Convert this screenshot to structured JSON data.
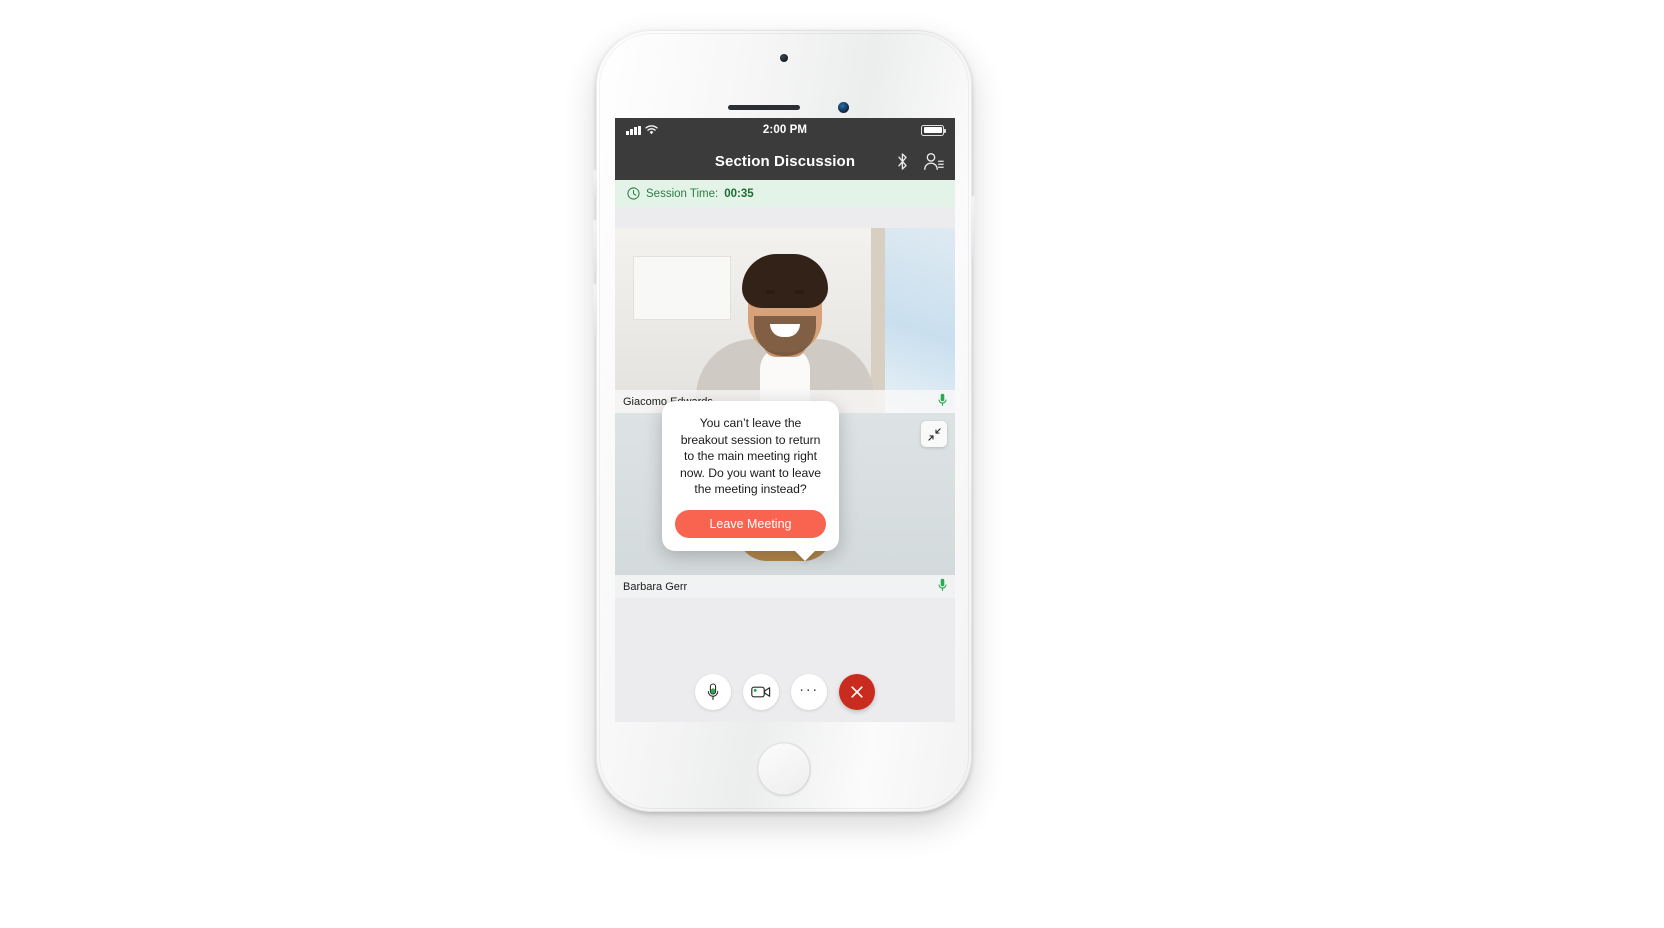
{
  "status_bar": {
    "signal_icon": "cellular-bars-icon",
    "wifi_icon": "wifi-icon",
    "time": "2:00 PM",
    "battery_icon": "battery-full-icon"
  },
  "nav_bar": {
    "title": "Section Discussion",
    "bluetooth_icon": "bluetooth-icon",
    "participants_icon": "participants-icon"
  },
  "session_bar": {
    "clock_icon": "clock-icon",
    "label": "Session Time:",
    "time": "00:35"
  },
  "participants": [
    {
      "name": "Giacomo Edwards",
      "mic_icon": "microphone-active-icon"
    },
    {
      "name": "Barbara Gerr",
      "mic_icon": "microphone-active-icon"
    }
  ],
  "collapse_button": {
    "icon": "collapse-arrows-icon"
  },
  "popover": {
    "message": "You can’t leave the breakout session to return to the main meeting right now. Do you want to leave the meeting instead?",
    "button_label": "Leave Meeting"
  },
  "toolbar": {
    "buttons": [
      {
        "name": "mute-button",
        "icon": "microphone-icon"
      },
      {
        "name": "video-button",
        "icon": "video-camera-icon"
      },
      {
        "name": "more-button",
        "icon": "ellipsis-icon",
        "label": "···"
      },
      {
        "name": "leave-button",
        "icon": "close-x-icon"
      }
    ]
  },
  "colors": {
    "nav_background": "#3b3b3b",
    "session_background": "#e4f3e8",
    "session_text": "#2e7d44",
    "accent_red": "#f96450",
    "leave_red": "#c92b1e",
    "mic_green": "#27ab50"
  }
}
